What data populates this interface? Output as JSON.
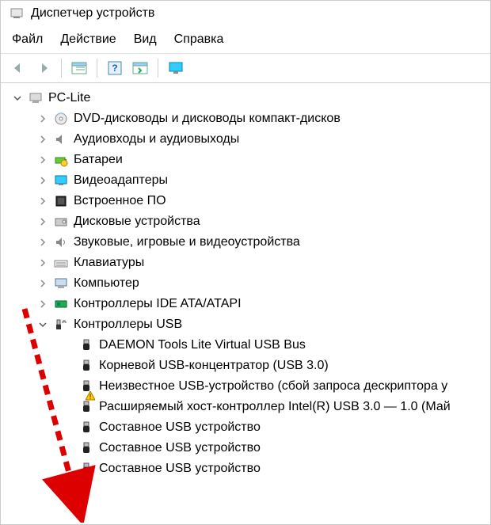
{
  "window": {
    "title": "Диспетчер устройств"
  },
  "menu": {
    "file": "Файл",
    "action": "Действие",
    "view": "Вид",
    "help": "Справка"
  },
  "tree": {
    "root": {
      "label": "PC-Lite",
      "expanded": true
    },
    "categories": [
      {
        "label": "DVD-дисководы и дисководы компакт-дисков",
        "icon": "dvd",
        "expanded": false
      },
      {
        "label": "Аудиовходы и аудиовыходы",
        "icon": "audio",
        "expanded": false
      },
      {
        "label": "Батареи",
        "icon": "battery",
        "expanded": false
      },
      {
        "label": "Видеоадаптеры",
        "icon": "display",
        "expanded": false
      },
      {
        "label": "Встроенное ПО",
        "icon": "firmware",
        "expanded": false
      },
      {
        "label": "Дисковые устройства",
        "icon": "disk",
        "expanded": false
      },
      {
        "label": "Звуковые, игровые и видеоустройства",
        "icon": "sound",
        "expanded": false
      },
      {
        "label": "Клавиатуры",
        "icon": "keyboard",
        "expanded": false
      },
      {
        "label": "Компьютер",
        "icon": "computer",
        "expanded": false
      },
      {
        "label": "Контроллеры IDE ATA/ATAPI",
        "icon": "ide",
        "expanded": false
      },
      {
        "label": "Контроллеры USB",
        "icon": "usb",
        "expanded": true,
        "children": [
          {
            "label": "DAEMON Tools Lite Virtual USB Bus",
            "icon": "usbplug",
            "warn": false
          },
          {
            "label": "Корневой USB-концентратор (USB 3.0)",
            "icon": "usbplug",
            "warn": false
          },
          {
            "label": "Неизвестное USB-устройство (сбой запроса дескриптора у",
            "icon": "usbplug",
            "warn": true
          },
          {
            "label": "Расширяемый хост-контроллер Intel(R) USB 3.0 — 1.0 (Май",
            "icon": "usbplug",
            "warn": false
          },
          {
            "label": "Составное USB устройство",
            "icon": "usbplug",
            "warn": false
          },
          {
            "label": "Составное USB устройство",
            "icon": "usbplug",
            "warn": false
          },
          {
            "label": "Составное USB устройство",
            "icon": "usbplug",
            "warn": false
          }
        ]
      }
    ]
  }
}
